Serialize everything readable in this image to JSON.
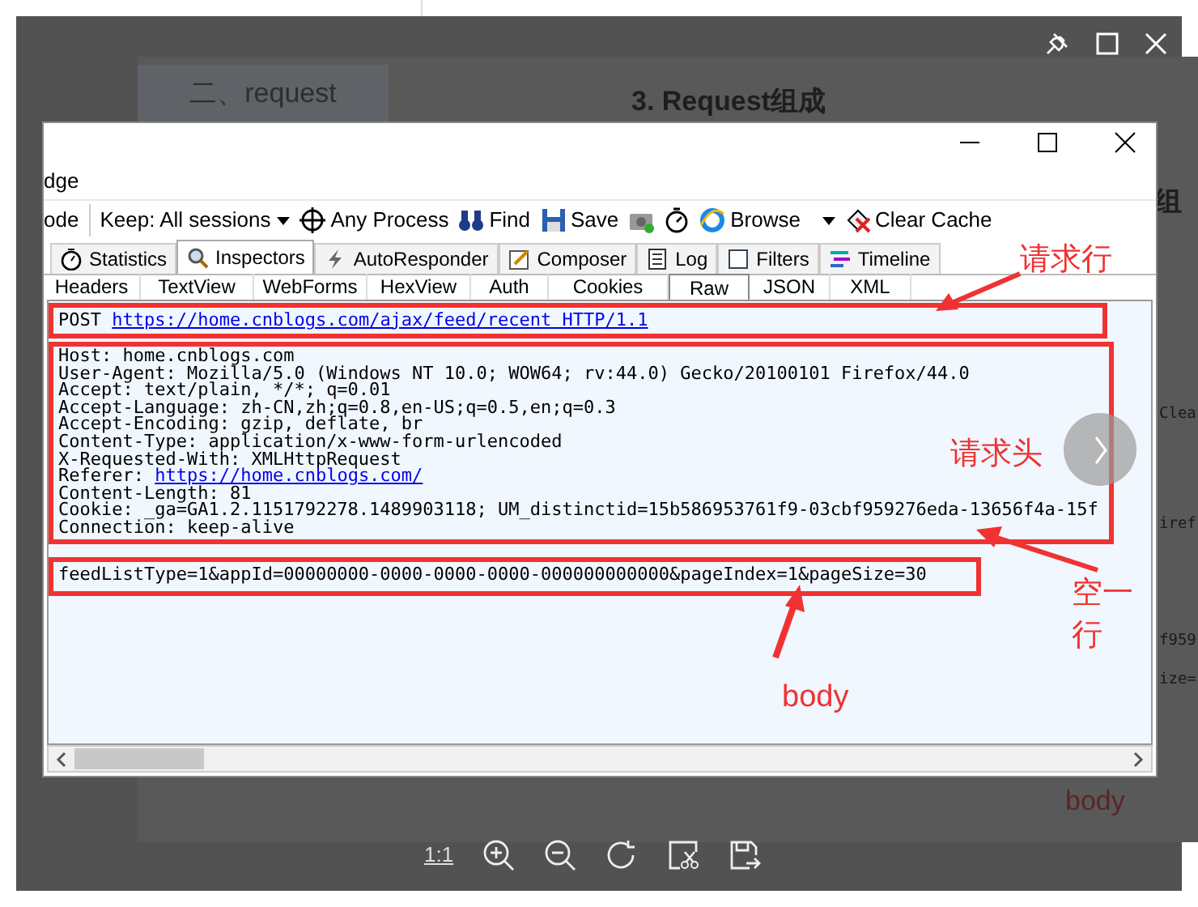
{
  "background_page": {
    "section_heading": "二、request",
    "title": "3. Request组成",
    "side_heading": "组",
    "fragments": [
      "Clea",
      "iref",
      "f959",
      "ize="
    ],
    "caption": "body"
  },
  "fiddler": {
    "menu": [
      "dge"
    ],
    "toolbar": [
      {
        "kind": "text",
        "label": "ode"
      },
      {
        "kind": "dropdown",
        "label": "Keep: All sessions"
      },
      {
        "kind": "button",
        "label": "Any Process"
      },
      {
        "kind": "button",
        "label": "Find"
      },
      {
        "kind": "button",
        "label": "Save"
      },
      {
        "kind": "icon"
      },
      {
        "kind": "icon"
      },
      {
        "kind": "dropdown_button",
        "label": "Browse"
      },
      {
        "kind": "button",
        "label": "Clear Cache"
      }
    ],
    "tabs": [
      {
        "label": "Statistics",
        "selected": false
      },
      {
        "label": "Inspectors",
        "selected": true
      },
      {
        "label": "AutoResponder",
        "selected": false
      },
      {
        "label": "Composer",
        "selected": false
      },
      {
        "label": "Log",
        "selected": false
      },
      {
        "label": "Filters",
        "selected": false
      },
      {
        "label": "Timeline",
        "selected": false
      }
    ],
    "subtabs": [
      {
        "label": "Headers",
        "selected": false
      },
      {
        "label": "TextView",
        "selected": false
      },
      {
        "label": "WebForms",
        "selected": false
      },
      {
        "label": "HexView",
        "selected": false
      },
      {
        "label": "Auth",
        "selected": false
      },
      {
        "label": "Cookies",
        "selected": false
      },
      {
        "label": "Raw",
        "selected": true
      },
      {
        "label": "JSON",
        "selected": false
      },
      {
        "label": "XML",
        "selected": false
      }
    ],
    "raw": {
      "method": "POST",
      "url": "https://home.cnblogs.com/ajax/feed/recent HTTP/1.1",
      "headers": [
        {
          "text": "Host: home.cnblogs.com"
        },
        {
          "text": "User-Agent: Mozilla/5.0 (Windows NT 10.0; WOW64; rv:44.0) Gecko/20100101 Firefox/44.0"
        },
        {
          "text": "Accept: text/plain, */*; q=0.01"
        },
        {
          "text": "Accept-Language: zh-CN,zh;q=0.8,en-US;q=0.5,en;q=0.3"
        },
        {
          "text": "Accept-Encoding: gzip, deflate, br"
        },
        {
          "text": "Content-Type: application/x-www-form-urlencoded"
        },
        {
          "text": "X-Requested-With: XMLHttpRequest"
        },
        {
          "text": "Referer:",
          "link": "https://home.cnblogs.com/"
        },
        {
          "text": "Content-Length: 81"
        },
        {
          "text": "Cookie: _ga=GA1.2.1151792278.1489903118; UM_distinctid=15b586953761f9-03cbf959276eda-13656f4a-15f"
        },
        {
          "text": "Connection: keep-alive"
        }
      ],
      "body": "feedListType=1&appId=00000000-0000-0000-0000-000000000000&pageIndex=1&pageSize=30"
    }
  },
  "annotations": [
    {
      "label": "请求行"
    },
    {
      "label": "请求头"
    },
    {
      "label": "空一行"
    },
    {
      "label": "body"
    }
  ],
  "viewer_toolbar": {
    "actual_size": "1:1"
  }
}
